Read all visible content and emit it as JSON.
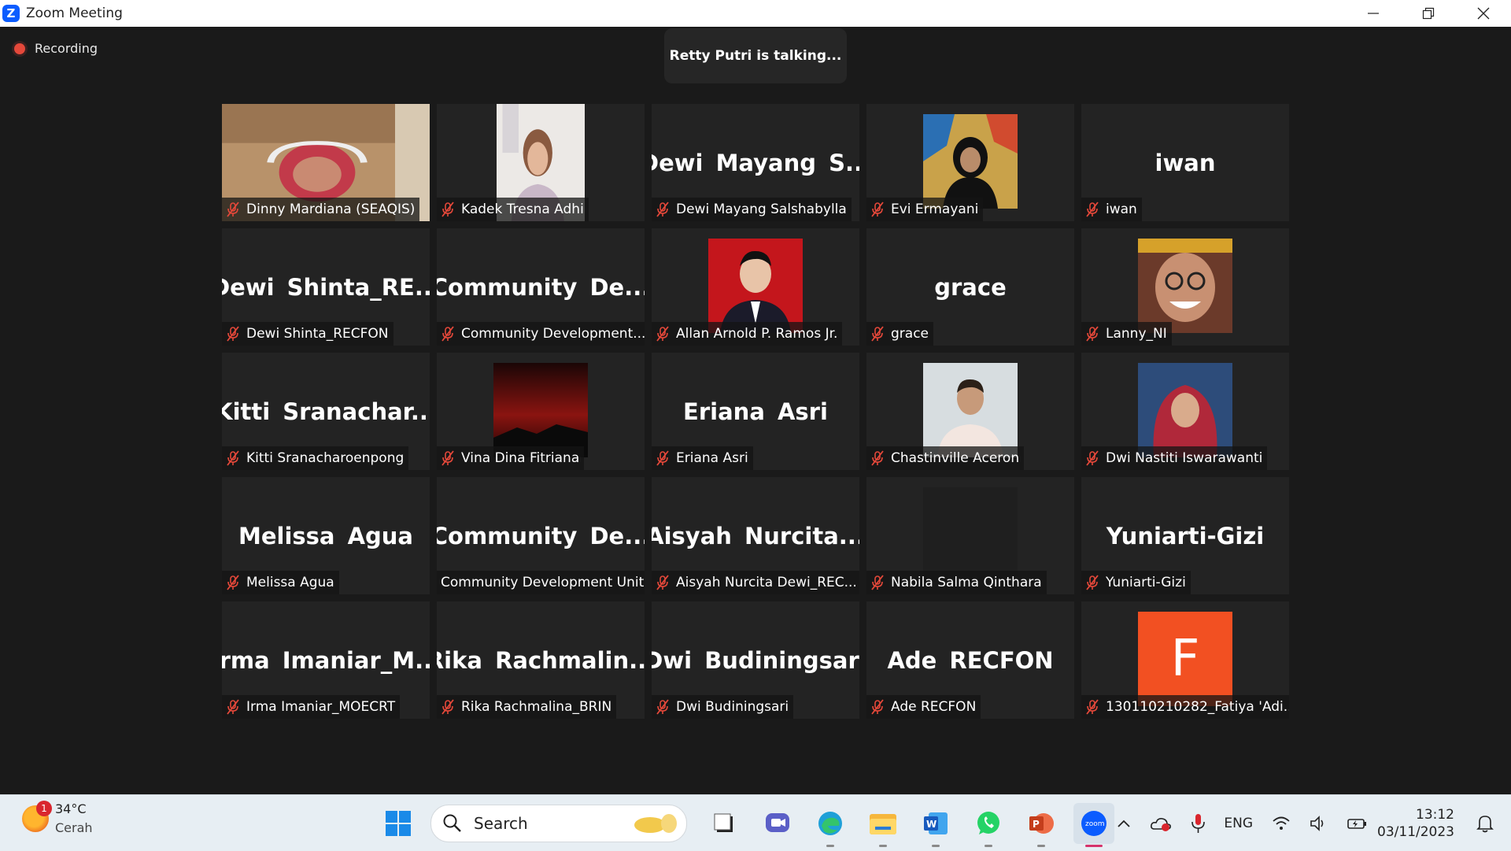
{
  "window": {
    "title": "Zoom Meeting",
    "logo_letter": "Z"
  },
  "meeting": {
    "recording_label": "Recording",
    "talking_label": "Retty Putri is talking...",
    "tiles": [
      {
        "display": "",
        "label": "Dinny Mardiana (SEAQIS)",
        "muted": true,
        "video": "cam-room"
      },
      {
        "display": "",
        "label": "Kadek Tresna Adhi",
        "muted": true,
        "video": "cam-portrait"
      },
      {
        "display": "Dewi Mayang S...",
        "label": "Dewi Mayang Salshabylla",
        "muted": true,
        "video": ""
      },
      {
        "display": "",
        "label": "Evi Ermayani",
        "muted": true,
        "video": "photo-graffiti"
      },
      {
        "display": "iwan",
        "label": "iwan",
        "muted": true,
        "video": ""
      },
      {
        "display": "Dewi Shinta_RE...",
        "label": "Dewi Shinta_RECFON",
        "muted": true,
        "video": ""
      },
      {
        "display": "Community De...",
        "label": "Community Development...",
        "muted": true,
        "video": ""
      },
      {
        "display": "",
        "label": "Allan Arnold P. Ramos Jr.",
        "muted": true,
        "video": "photo-red"
      },
      {
        "display": "grace",
        "label": "grace",
        "muted": true,
        "video": ""
      },
      {
        "display": "",
        "label": "Lanny_NI",
        "muted": true,
        "video": "photo-smile"
      },
      {
        "display": "Kitti Sranachar...",
        "label": "Kitti Sranacharoenpong",
        "muted": true,
        "video": ""
      },
      {
        "display": "",
        "label": "Vina Dina Fitriana",
        "muted": true,
        "video": "photo-sunset"
      },
      {
        "display": "Eriana Asri",
        "label": "Eriana Asri",
        "muted": true,
        "video": ""
      },
      {
        "display": "",
        "label": "Chastinville Aceron",
        "muted": true,
        "video": "photo-man"
      },
      {
        "display": "",
        "label": "Dwi Nastiti Iswarawanti",
        "muted": true,
        "video": "photo-hijab"
      },
      {
        "display": "Melissa Agua",
        "label": "Melissa Agua",
        "muted": true,
        "video": ""
      },
      {
        "display": "Community De...",
        "label": "Community Development Unit",
        "muted": false,
        "video": ""
      },
      {
        "display": "Aisyah Nurcita...",
        "label": "Aisyah Nurcita Dewi_REC...",
        "muted": true,
        "video": ""
      },
      {
        "display": "",
        "label": "Nabila Salma Qinthara",
        "muted": true,
        "video": "photo-dark"
      },
      {
        "display": "Yuniarti-Gizi",
        "label": "Yuniarti-Gizi",
        "muted": true,
        "video": ""
      },
      {
        "display": "Irma Imaniar_M...",
        "label": "Irma Imaniar_MOECRT",
        "muted": true,
        "video": ""
      },
      {
        "display": "Rika Rachmalin...",
        "label": "Rika Rachmalina_BRIN",
        "muted": true,
        "video": ""
      },
      {
        "display": "Dwi Budiningsari",
        "label": "Dwi Budiningsari",
        "muted": true,
        "video": ""
      },
      {
        "display": "Ade RECFON",
        "label": "Ade RECFON",
        "muted": true,
        "video": ""
      },
      {
        "display": "",
        "label": "130110210282_Fatiya 'Adi...",
        "muted": true,
        "video": "avatar-letter",
        "avatar_letter": "F"
      }
    ]
  },
  "taskbar": {
    "weather": {
      "temp": "34°C",
      "condition": "Cerah",
      "badge": "1"
    },
    "search_placeholder": "Search",
    "apps": [
      "windows-start-icon",
      "task-view-icon",
      "meet-icon",
      "edge-icon",
      "file-explorer-icon",
      "word-icon",
      "whatsapp-icon",
      "powerpoint-icon",
      "zoom-icon"
    ],
    "tray": {
      "language": "ENG",
      "time": "13:12",
      "date": "03/11/2023"
    }
  },
  "colors": {
    "zoom_blue": "#0b5cff",
    "tile_bg": "#232323",
    "muted_red": "#e5483a",
    "avatar_orange": "#f25022"
  }
}
